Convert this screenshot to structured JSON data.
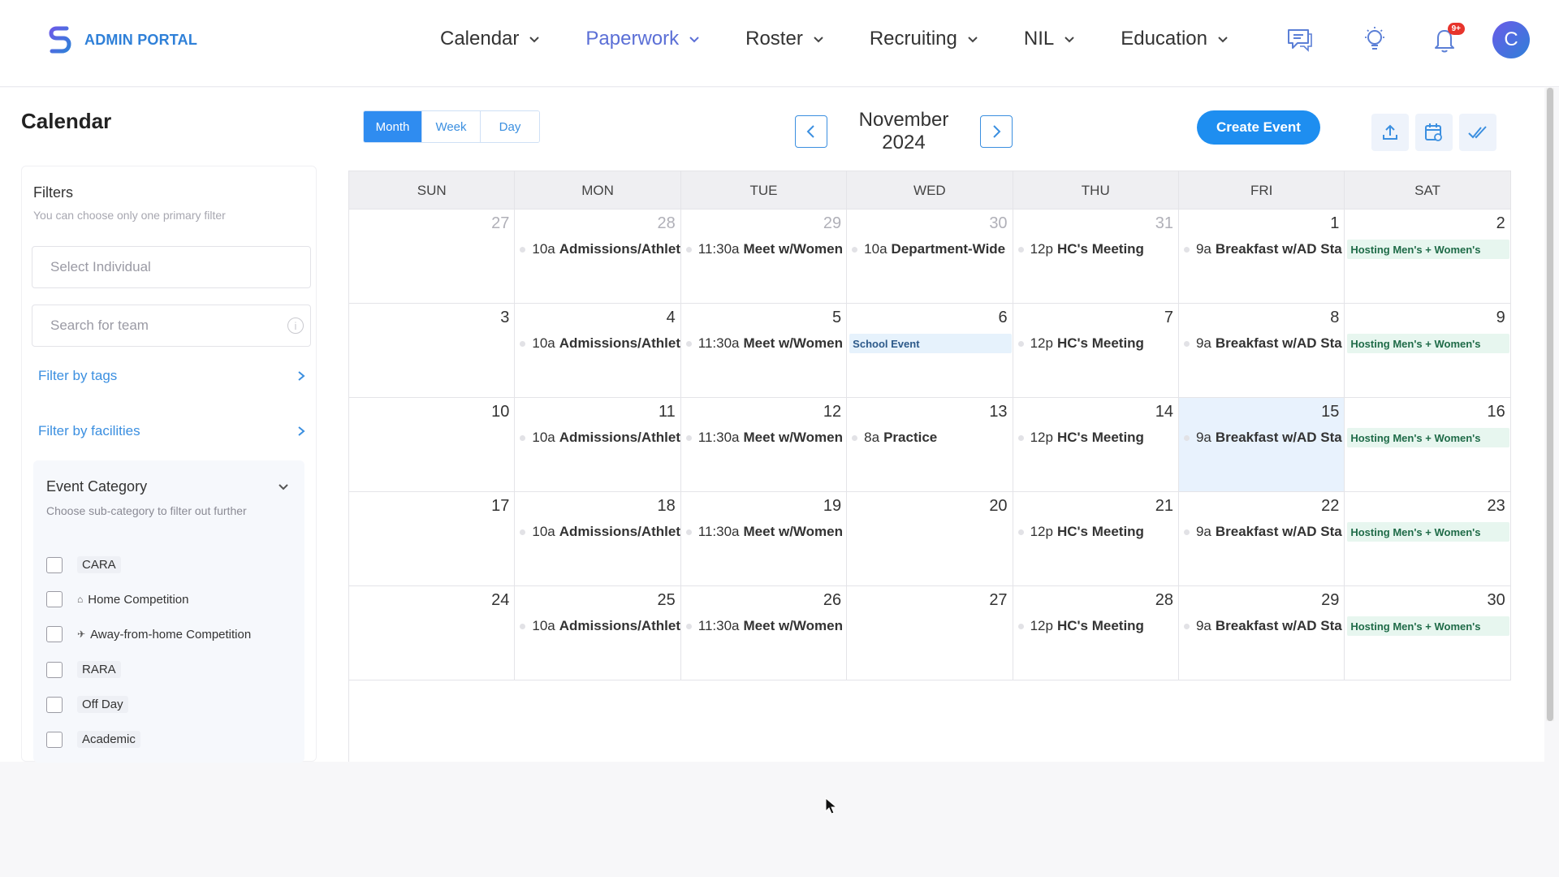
{
  "brand": {
    "name": "ADMIN PORTAL",
    "color": "#2f80d8"
  },
  "nav": [
    {
      "label": "Calendar",
      "active": false
    },
    {
      "label": "Paperwork",
      "active": true
    },
    {
      "label": "Roster",
      "active": false
    },
    {
      "label": "Recruiting",
      "active": false
    },
    {
      "label": "NIL",
      "active": false
    },
    {
      "label": "Education",
      "active": false
    }
  ],
  "header_icons": [
    "chat-icon",
    "lightbulb-icon",
    "bell-icon"
  ],
  "notification_badge": "9+",
  "avatar_initial": "C",
  "page_title": "Calendar",
  "filters": {
    "title": "Filters",
    "hint": "You can choose only one primary filter",
    "individual_placeholder": "Select Individual",
    "team_placeholder": "Search for team",
    "tags_link": "Filter by tags",
    "facilities_link": "Filter by facilities"
  },
  "event_category": {
    "title": "Event Category",
    "hint": "Choose sub-category to filter out further",
    "items": [
      {
        "label": "CARA",
        "icon": ""
      },
      {
        "label": "Home Competition",
        "icon": "home-icon"
      },
      {
        "label": "Away-from-home Competition",
        "icon": "plane-icon"
      },
      {
        "label": "RARA",
        "icon": ""
      },
      {
        "label": "Off Day",
        "icon": ""
      },
      {
        "label": "Academic",
        "icon": ""
      }
    ]
  },
  "views": [
    {
      "label": "Month",
      "active": true
    },
    {
      "label": "Week",
      "active": false
    },
    {
      "label": "Day",
      "active": false
    }
  ],
  "current_month": "November 2024",
  "create_event_label": "Create Event",
  "toolbar_icons": [
    "export-icon",
    "calendar-settings-icon",
    "check-all-icon"
  ],
  "weekdays": [
    "SUN",
    "MON",
    "TUE",
    "WED",
    "THU",
    "FRI",
    "SAT"
  ],
  "weeks": [
    [
      {
        "day": "27",
        "muted": true
      },
      {
        "day": "28",
        "muted": true,
        "time": "10a",
        "title": "Admissions/Athlet"
      },
      {
        "day": "29",
        "muted": true,
        "time": "11:30a",
        "title": "Meet w/Women"
      },
      {
        "day": "30",
        "muted": true,
        "time": "10a",
        "title": "Department-Wide"
      },
      {
        "day": "31",
        "muted": true,
        "time": "12p",
        "title": "HC's Meeting"
      },
      {
        "day": "1",
        "time": "9a",
        "title": "Breakfast w/AD Sta"
      },
      {
        "day": "2",
        "banner": "Hosting Men's + Women's",
        "banner_color": "green"
      }
    ],
    [
      {
        "day": "3"
      },
      {
        "day": "4",
        "time": "10a",
        "title": "Admissions/Athlet"
      },
      {
        "day": "5",
        "time": "11:30a",
        "title": "Meet w/Women"
      },
      {
        "day": "6",
        "banner": "School Event",
        "banner_color": "blue"
      },
      {
        "day": "7",
        "time": "12p",
        "title": "HC's Meeting"
      },
      {
        "day": "8",
        "time": "9a",
        "title": "Breakfast w/AD Sta"
      },
      {
        "day": "9",
        "banner": "Hosting Men's + Women's",
        "banner_color": "green"
      }
    ],
    [
      {
        "day": "10"
      },
      {
        "day": "11",
        "time": "10a",
        "title": "Admissions/Athlet"
      },
      {
        "day": "12",
        "time": "11:30a",
        "title": "Meet w/Women"
      },
      {
        "day": "13",
        "time": "8a",
        "title": "Practice"
      },
      {
        "day": "14",
        "time": "12p",
        "title": "HC's Meeting"
      },
      {
        "day": "15",
        "today": true,
        "time": "9a",
        "title": "Breakfast w/AD Sta"
      },
      {
        "day": "16",
        "banner": "Hosting Men's + Women's",
        "banner_color": "green"
      }
    ],
    [
      {
        "day": "17"
      },
      {
        "day": "18",
        "time": "10a",
        "title": "Admissions/Athlet"
      },
      {
        "day": "19",
        "time": "11:30a",
        "title": "Meet w/Women"
      },
      {
        "day": "20"
      },
      {
        "day": "21",
        "time": "12p",
        "title": "HC's Meeting"
      },
      {
        "day": "22",
        "time": "9a",
        "title": "Breakfast w/AD Sta"
      },
      {
        "day": "23",
        "banner": "Hosting Men's + Women's",
        "banner_color": "green"
      }
    ],
    [
      {
        "day": "24"
      },
      {
        "day": "25",
        "time": "10a",
        "title": "Admissions/Athlet"
      },
      {
        "day": "26",
        "time": "11:30a",
        "title": "Meet w/Women"
      },
      {
        "day": "27"
      },
      {
        "day": "28",
        "time": "12p",
        "title": "HC's Meeting"
      },
      {
        "day": "29",
        "time": "9a",
        "title": "Breakfast w/AD Sta"
      },
      {
        "day": "30",
        "banner": "Hosting Men's + Women's",
        "banner_color": "green"
      }
    ]
  ]
}
